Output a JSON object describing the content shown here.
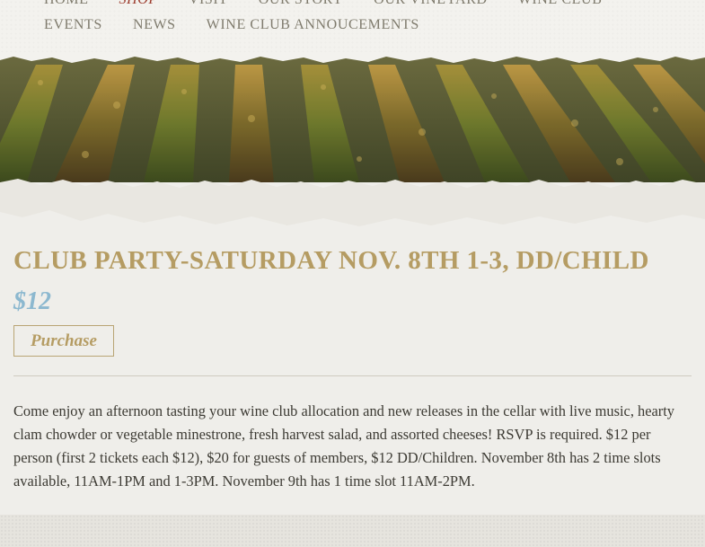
{
  "nav": {
    "row1": [
      "HOME",
      "SHOP",
      "VISIT",
      "OUR STORY",
      "OUR VINEYARD",
      "WINE CLUB"
    ],
    "row2": [
      "EVENTS",
      "NEWS",
      "WINE CLUB ANNOUCEMENTS"
    ],
    "active": "SHOP"
  },
  "product": {
    "title": "CLUB PARTY-SATURDAY NOV. 8TH 1-3, DD/CHILD",
    "price": "$12",
    "purchase_label": "Purchase",
    "description": "Come enjoy an afternoon tasting your wine club allocation and new releases in the cellar with live music, hearty clam chowder or vegetable minestrone, fresh harvest salad, and assorted cheeses! RSVP is required. $12 per person (first 2 tickets each $12), $20 for guests of members, $12 DD/Children. November 8th has 2 time slots available, 11AM-1PM and 1-3PM. November 9th has 1 time slot 11AM-2PM."
  },
  "colors": {
    "title": "#b59c63",
    "price": "#8cb8cf",
    "nav_active": "#9b3a2c",
    "nav_text": "#7f7b6d",
    "body_text": "#3c3a33"
  }
}
